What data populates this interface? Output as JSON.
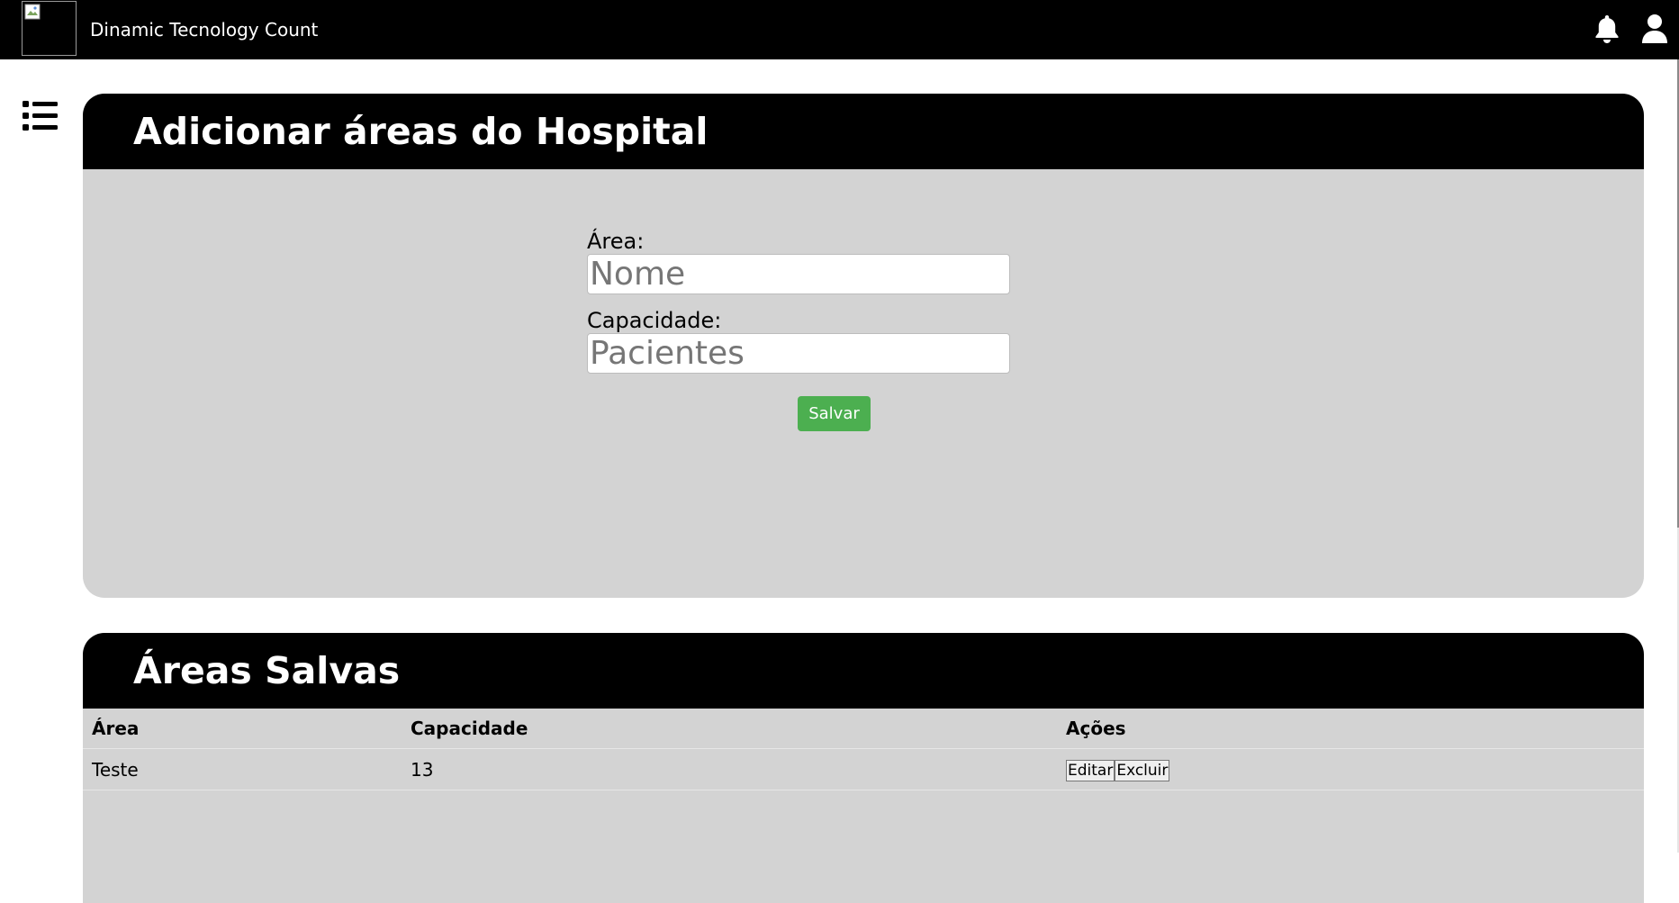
{
  "header": {
    "app_title": "Dinamic Tecnology Count",
    "icons": [
      "broken-image-icon",
      "bell-icon",
      "user-icon"
    ]
  },
  "sidebar": {
    "toggle_icon": "list-icon"
  },
  "add_card": {
    "title": "Adicionar áreas do Hospital",
    "area_label": "Área:",
    "area_placeholder": "Nome",
    "area_value": "",
    "capacity_label": "Capacidade:",
    "capacity_placeholder": "Pacientes",
    "capacity_value": "",
    "save_label": "Salvar",
    "save_color": "#4caf50"
  },
  "saved_card": {
    "title": "Áreas Salvas",
    "columns": [
      "Área",
      "Capacidade",
      "Ações"
    ],
    "rows": [
      {
        "area": "Teste",
        "capacity": "13",
        "edit_label": "Editar",
        "delete_label": "Excluir"
      }
    ]
  },
  "colors": {
    "header_bg": "#000000",
    "card_bg": "#d3d3d3",
    "page_bg": "#ffffff"
  }
}
